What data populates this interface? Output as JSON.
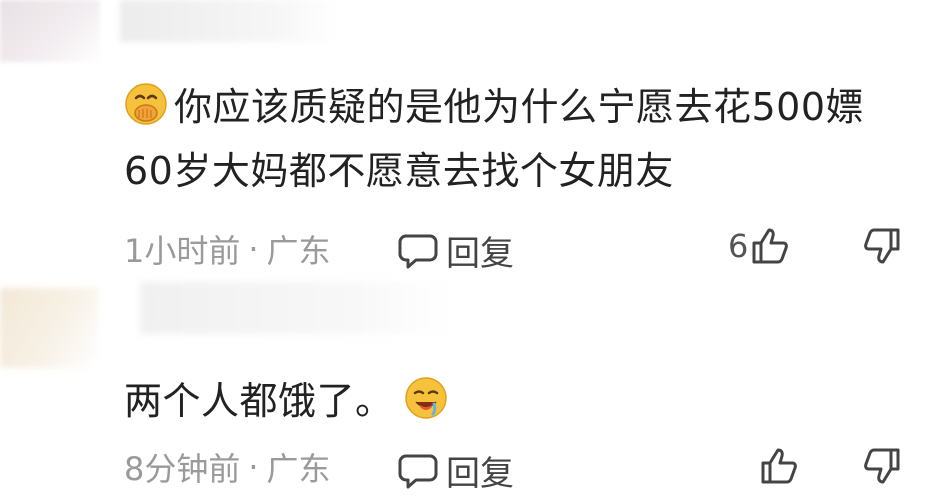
{
  "comments": [
    {
      "text": "你应该质疑的是他为什么宁愿去花500嫖60岁大妈都不愿意去找个女朋友",
      "emoji": "face-with-hand-over-mouth-icon",
      "time": "1小时前",
      "separator": "·",
      "location": "广东",
      "reply_label": "回复",
      "likes": "6"
    },
    {
      "text": "两个人都饿了。",
      "emoji": "drooling-face-icon",
      "time": "8分钟前",
      "separator": "·",
      "location": "广东",
      "reply_label": "回复",
      "likes": ""
    }
  ],
  "colors": {
    "text": "#222222",
    "meta": "#9a9a9a",
    "icon": "#444444"
  }
}
